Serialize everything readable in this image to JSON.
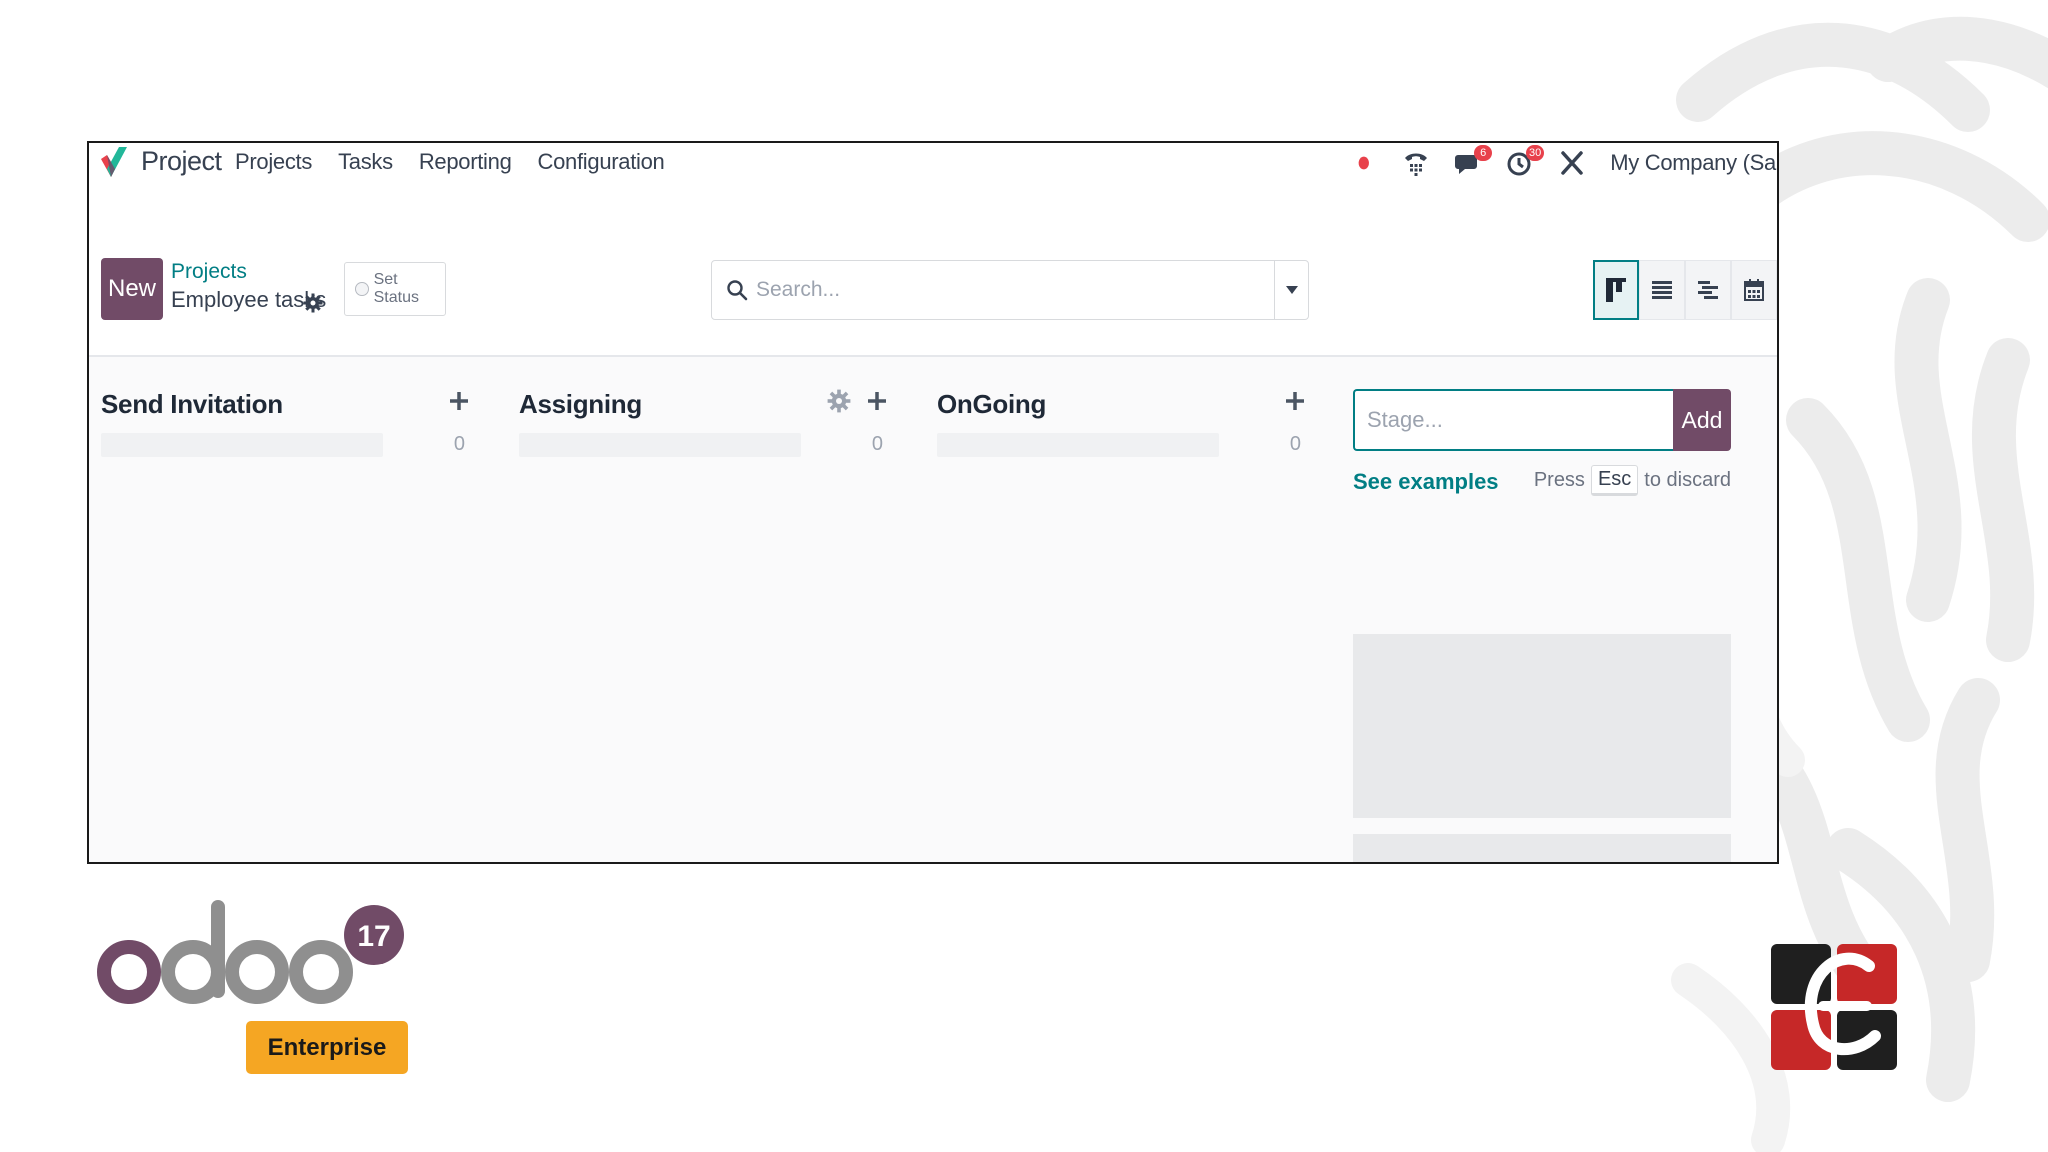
{
  "navbar": {
    "app_name": "Project",
    "menu": [
      "Projects",
      "Tasks",
      "Reporting",
      "Configuration"
    ],
    "messages_badge": "6",
    "activities_badge": "30",
    "company": "My Company (Sar"
  },
  "control_panel": {
    "new_label": "New",
    "breadcrumb_parent": "Projects",
    "breadcrumb_current": "Employee tasks",
    "set_status_label": "Set Status",
    "search_placeholder": "Search..."
  },
  "kanban": {
    "columns": [
      {
        "title": "Send Invitation",
        "count": "0"
      },
      {
        "title": "Assigning",
        "count": "0"
      },
      {
        "title": "OnGoing",
        "count": "0"
      }
    ],
    "stage_form": {
      "placeholder": "Stage...",
      "add_label": "Add",
      "see_examples": "See examples",
      "press": "Press",
      "esc": "Esc",
      "to_discard": "to discard"
    }
  },
  "branding": {
    "odoo_word": "odoo",
    "version": "17",
    "edition": "Enterprise"
  },
  "colors": {
    "primary": "#714b67",
    "accent": "#017e84",
    "badge": "#e8414b",
    "enterprise": "#f5a623"
  }
}
